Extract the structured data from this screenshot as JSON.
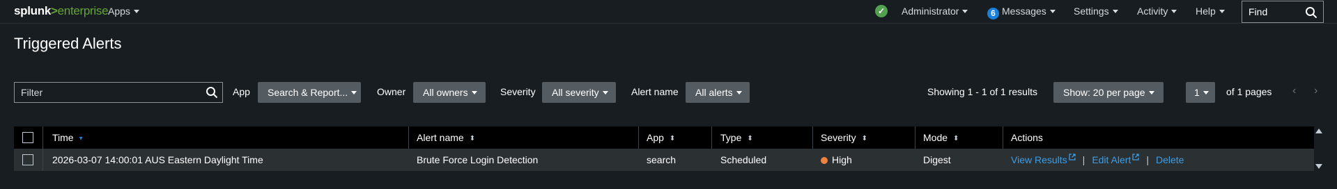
{
  "brand": {
    "name": "splunk",
    "sep": ">",
    "product": "enterprise"
  },
  "nav": {
    "apps": "Apps",
    "user": "Administrator",
    "messages_count": "6",
    "messages": "Messages",
    "settings": "Settings",
    "activity": "Activity",
    "help": "Help",
    "find_placeholder": "Find"
  },
  "page": {
    "title": "Triggered Alerts"
  },
  "filters": {
    "filter_placeholder": "Filter",
    "app_label": "App",
    "app_value": "Search & Report...",
    "owner_label": "Owner",
    "owner_value": "All owners",
    "severity_label": "Severity",
    "severity_value": "All severity",
    "alert_name_label": "Alert name",
    "alert_name_value": "All alerts"
  },
  "pagination": {
    "results_text": "Showing 1 - 1 of 1 results",
    "per_page": "Show: 20 per page",
    "page": "1",
    "of_pages": "of 1 pages",
    "prev": "‹",
    "next": "›"
  },
  "table": {
    "headers": {
      "time": "Time",
      "alert_name": "Alert name",
      "app": "App",
      "type": "Type",
      "severity": "Severity",
      "mode": "Mode",
      "actions": "Actions"
    },
    "rows": [
      {
        "time": "2026-03-07 14:00:01 AUS Eastern Daylight Time",
        "alert_name": "Brute Force Login Detection",
        "app": "search",
        "type": "Scheduled",
        "severity": "High",
        "mode": "Digest",
        "view_results": "View Results",
        "edit_alert": "Edit Alert",
        "delete": "Delete"
      }
    ]
  },
  "colors": {
    "background": "#171d21",
    "accent_green": "#65a637",
    "link_blue": "#3c9ee6",
    "severity_high": "#f1813f",
    "dropdown_bg": "#545b61"
  }
}
